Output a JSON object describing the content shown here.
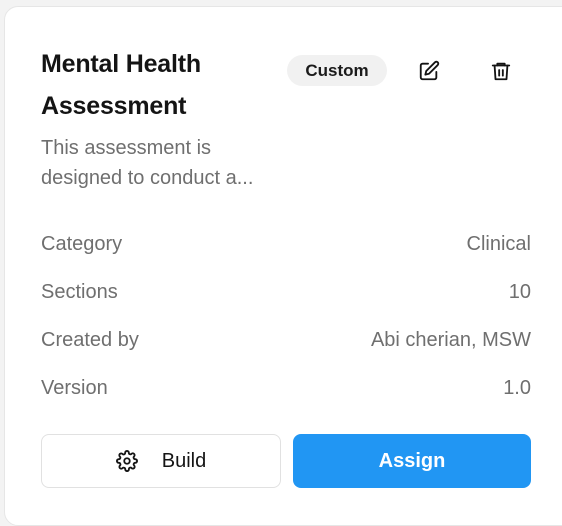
{
  "card": {
    "title": "Mental Health Assessment",
    "badge": "Custom",
    "description": "This assessment is designed to conduct a...",
    "details": [
      {
        "label": "Category",
        "value": "Clinical"
      },
      {
        "label": "Sections",
        "value": "10"
      },
      {
        "label": "Created by",
        "value": "Abi cherian, MSW"
      },
      {
        "label": "Version",
        "value": "1.0"
      }
    ],
    "actions": {
      "build_label": "Build",
      "assign_label": "Assign"
    },
    "icons": {
      "edit": "edit-icon",
      "delete": "trash-icon",
      "build": "gear-icon"
    },
    "colors": {
      "primary": "#2196f3",
      "badge_bg": "#f1f1f1",
      "muted_text": "#6f6f6f"
    }
  }
}
